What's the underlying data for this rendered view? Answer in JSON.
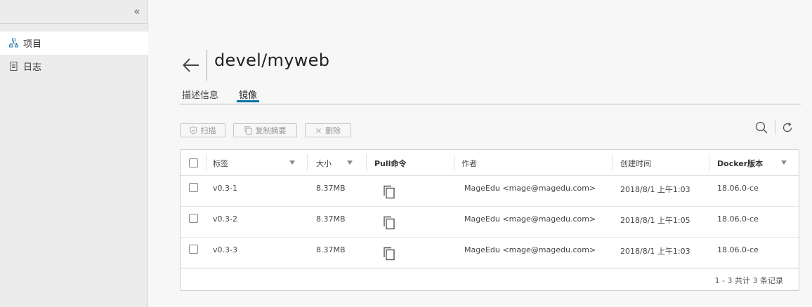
{
  "sidebar": {
    "collapse_icon": "double-chevron-left-icon",
    "items": [
      {
        "label": "项目",
        "icon": "project-tree-icon",
        "active": true
      },
      {
        "label": "日志",
        "icon": "log-document-icon",
        "active": false
      }
    ]
  },
  "header": {
    "title": "devel/myweb",
    "back_icon": "arrow-left-icon"
  },
  "tabs": [
    {
      "label": "描述信息",
      "active": false
    },
    {
      "label": "镜像",
      "active": true
    }
  ],
  "toolbar": {
    "scan_label": "扫描",
    "copy_digest_label": "复制摘要",
    "delete_label": "删除",
    "search_icon": "search-icon",
    "refresh_icon": "refresh-icon"
  },
  "table": {
    "columns": [
      "标签",
      "大小",
      "Pull命令",
      "作者",
      "创建时间",
      "Docker版本"
    ],
    "rows": [
      {
        "tag": "v0.3-1",
        "size": "8.37MB",
        "author": "MageEdu <mage@magedu.com>",
        "created": "2018/8/1 上午1:03",
        "docker": "18.06.0-ce"
      },
      {
        "tag": "v0.3-2",
        "size": "8.37MB",
        "author": "MageEdu <mage@magedu.com>",
        "created": "2018/8/1 上午1:05",
        "docker": "18.06.0-ce"
      },
      {
        "tag": "v0.3-3",
        "size": "8.37MB",
        "author": "MageEdu <mage@magedu.com>",
        "created": "2018/8/1 上午1:03",
        "docker": "18.06.0-ce"
      }
    ],
    "footer": "1 - 3 共计 3 条记录"
  },
  "colors": {
    "accent": "#0072a3",
    "sidebar_bg": "#ececec",
    "page_bg": "#f7f7f7"
  }
}
